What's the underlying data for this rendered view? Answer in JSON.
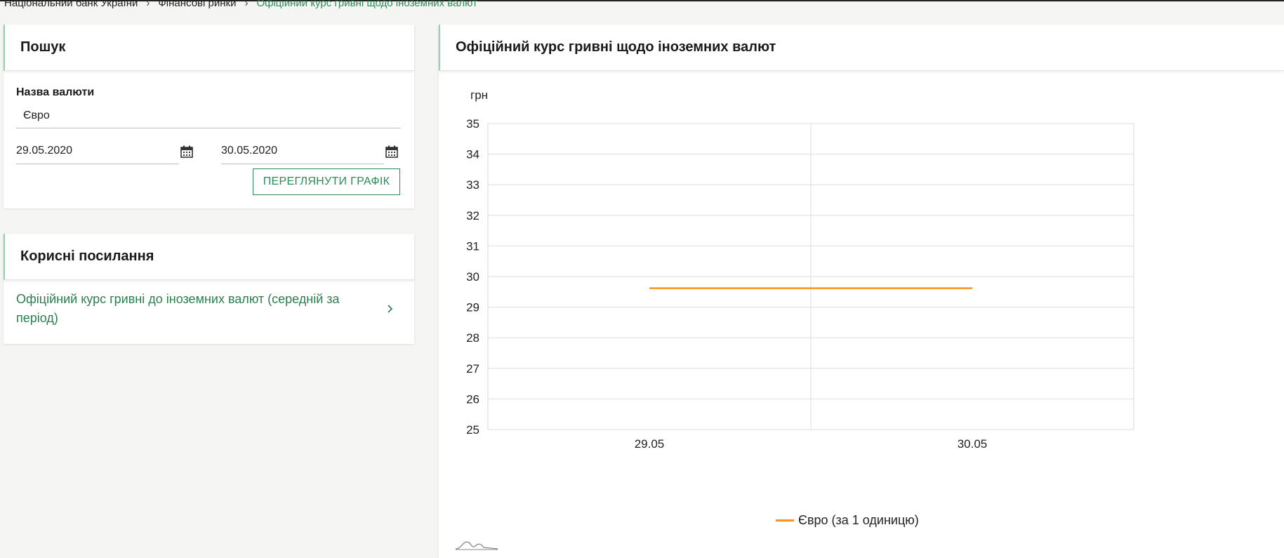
{
  "breadcrumb": {
    "items": [
      "Національний банк України",
      "Фінансові ринки",
      "Офіційний курс гривні щодо іноземних валют"
    ]
  },
  "search": {
    "title": "Пошук",
    "currency_label": "Назва валюти",
    "currency_value": "Євро",
    "date_from": "29.05.2020",
    "date_to": "30.05.2020",
    "view_button": "ПЕРЕГЛЯНУТИ ГРАФІК"
  },
  "links": {
    "title": "Корисні посилання",
    "items": [
      {
        "label": "Офіційний курс гривні до іноземних валют (середній за період)"
      }
    ]
  },
  "chart": {
    "title": "Офіційний курс гривні щодо іноземних валют",
    "line_color": "#f7941d",
    "accent": "#2e8b57"
  },
  "chart_data": {
    "type": "line",
    "categories": [
      "29.05",
      "30.05"
    ],
    "series": [
      {
        "name": "Євро (за 1 одиницю)",
        "values": [
          29.62,
          29.62
        ]
      }
    ],
    "ylabel": "грн",
    "ylim": [
      25,
      35
    ],
    "yticks": [
      25,
      26,
      27,
      28,
      29,
      30,
      31,
      32,
      33,
      34,
      35
    ],
    "grid": true,
    "legend": "bottom"
  }
}
